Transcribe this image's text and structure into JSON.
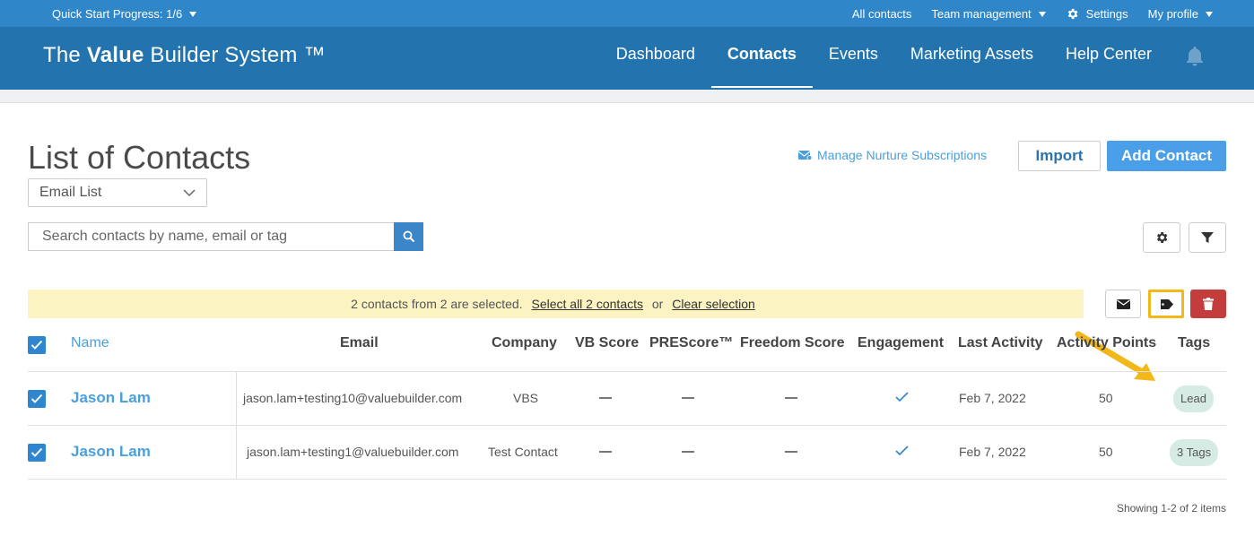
{
  "topbar": {
    "quick_start": "Quick Start Progress: 1/6",
    "all_contacts": "All contacts",
    "team_management": "Team management",
    "settings": "Settings",
    "my_profile": "My profile"
  },
  "nav": {
    "brand_pre": "The ",
    "brand_bold": "Value",
    "brand_post": " Builder System ™",
    "tabs": [
      "Dashboard",
      "Contacts",
      "Events",
      "Marketing Assets",
      "Help Center"
    ],
    "active_tab": "Contacts"
  },
  "page": {
    "title": "List of Contacts",
    "list_select": "Email List",
    "manage_nurture": "Manage Nurture Subscriptions",
    "import": "Import",
    "add_contact": "Add Contact",
    "search_placeholder": "Search contacts by name, email or tag"
  },
  "selection": {
    "text": "2 contacts from 2 are selected.",
    "select_all": "Select all 2 contacts",
    "or": "or",
    "clear": "Clear selection"
  },
  "table": {
    "headers": {
      "name": "Name",
      "email": "Email",
      "company": "Company",
      "vb_score": "VB Score",
      "prescore": "PREScore™",
      "freedom": "Freedom Score",
      "engagement": "Engagement",
      "last_activity": "Last Activity",
      "activity_points": "Activity Points",
      "tags": "Tags"
    },
    "rows": [
      {
        "name": "Jason Lam",
        "email": "jason.lam+testing10@valuebuilder.com",
        "company": "VBS",
        "last_activity": "Feb 7, 2022",
        "points": "50",
        "tag": "Lead"
      },
      {
        "name": "Jason Lam",
        "email": "jason.lam+testing1@valuebuilder.com",
        "company": "Test Contact",
        "last_activity": "Feb 7, 2022",
        "points": "50",
        "tag": "3 Tags"
      }
    ]
  },
  "footer": {
    "showing": "Showing 1-2 of 2 items"
  },
  "colors": {
    "nav": "#2273ae",
    "topbar": "#2f86c8",
    "accent": "#4b9fe8",
    "highlight": "#f2b819",
    "danger": "#c43d3d"
  }
}
